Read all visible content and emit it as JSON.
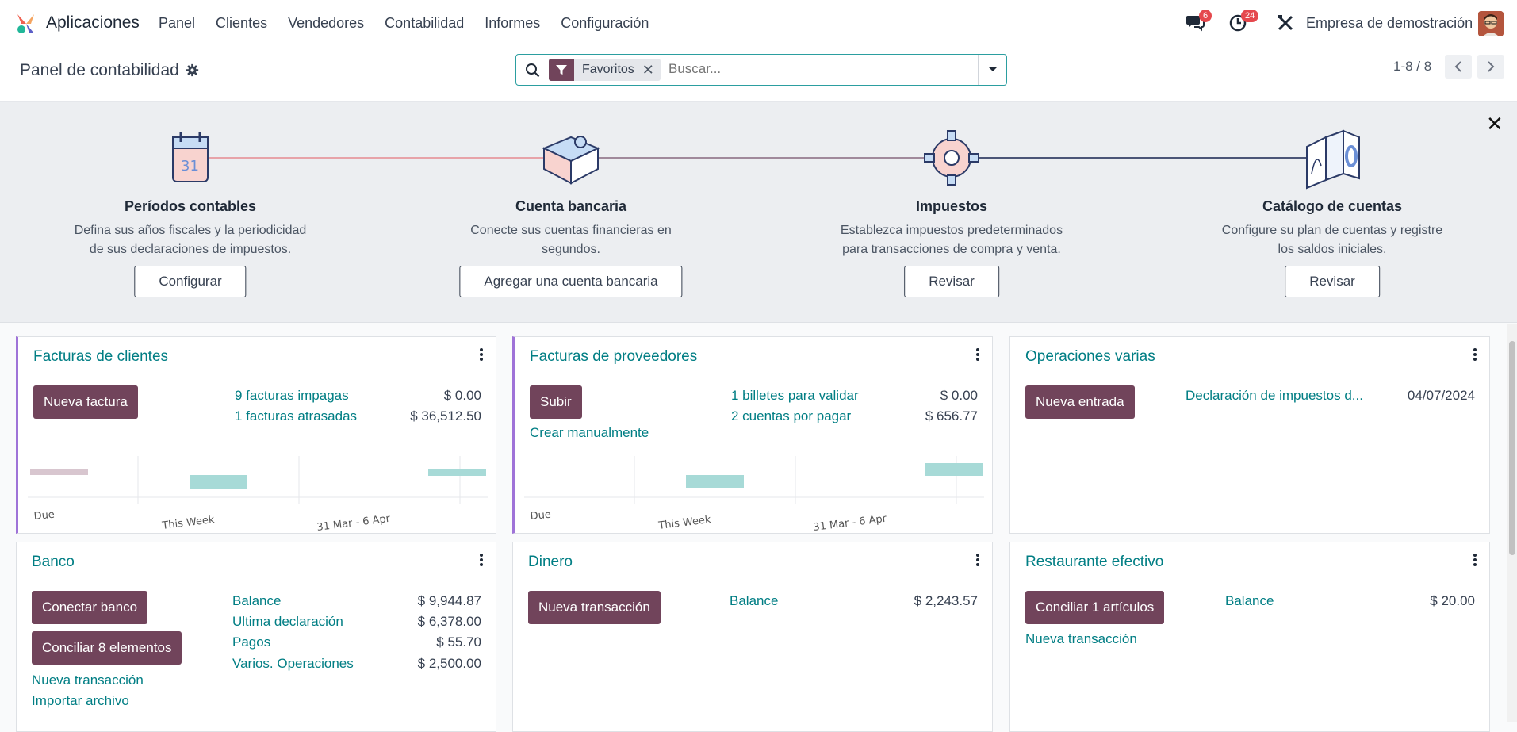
{
  "nav": {
    "app_name": "Aplicaciones",
    "menu": [
      "Panel",
      "Clientes",
      "Vendedores",
      "Contabilidad",
      "Informes",
      "Configuración"
    ],
    "messages_badge": "6",
    "activities_badge": "24",
    "company": "Empresa de demostración"
  },
  "control": {
    "title": "Panel de contabilidad",
    "facet_label": "Favoritos",
    "search_placeholder": "Buscar...",
    "pager": "1-8 / 8"
  },
  "onboarding": {
    "steps": [
      {
        "title": "Períodos contables",
        "desc1": "Defina sus años fiscales y la periodicidad",
        "desc2": "de sus declaraciones de impuestos.",
        "button": "Configurar"
      },
      {
        "title": "Cuenta bancaria",
        "desc1": "Conecte sus cuentas financieras en",
        "desc2": "segundos.",
        "button": "Agregar una cuenta bancaria"
      },
      {
        "title": "Impuestos",
        "desc1": "Establezca impuestos predeterminados",
        "desc2": "para transacciones de compra y venta.",
        "button": "Revisar"
      },
      {
        "title": "Catálogo de cuentas",
        "desc1": "Configure su plan de cuentas y registre",
        "desc2": "los saldos iniciales.",
        "button": "Revisar"
      }
    ]
  },
  "cards": {
    "sales": {
      "title": "Facturas de clientes",
      "button": "Nueva factura",
      "rows": [
        {
          "label": "9 facturas impagas",
          "value": "$ 0.00"
        },
        {
          "label": "1 facturas atrasadas",
          "value": "$ 36,512.50"
        }
      ],
      "chart_labels": [
        "Due",
        "This Week",
        "31 Mar - 6 Apr"
      ]
    },
    "purchase": {
      "title": "Facturas de proveedores",
      "button": "Subir",
      "link": "Crear manualmente",
      "rows": [
        {
          "label": "1 billetes para validar",
          "value": "$ 0.00"
        },
        {
          "label": "2 cuentas por pagar",
          "value": "$ 656.77"
        }
      ],
      "chart_labels": [
        "Due",
        "This Week",
        "31 Mar - 6 Apr"
      ]
    },
    "misc": {
      "title": "Operaciones varias",
      "button": "Nueva entrada",
      "row_label": "Declaración de impuestos d...",
      "row_value": "04/07/2024"
    },
    "bank": {
      "title": "Banco",
      "button1": "Conectar banco",
      "button2": "Conciliar 8 elementos",
      "links": [
        "Nueva transacción",
        "Importar archivo"
      ],
      "rows": [
        {
          "label": "Balance",
          "value": "$ 9,944.87"
        },
        {
          "label": "Ultima declaración",
          "value": "$ 6,378.00"
        },
        {
          "label": "Pagos",
          "value": "$ 55.70"
        },
        {
          "label": "Varios. Operaciones",
          "value": "$ 2,500.00"
        }
      ]
    },
    "cash": {
      "title": "Dinero",
      "button": "Nueva transacción",
      "row_label": "Balance",
      "row_value": "$ 2,243.57"
    },
    "resto": {
      "title": "Restaurante efectivo",
      "button": "Conciliar 1 artículos",
      "link": "Nueva transacción",
      "row_label": "Balance",
      "row_value": "$ 20.00"
    }
  },
  "colors": {
    "primary": "#71445b",
    "link": "#017e84",
    "accent_border": "#9f73d8",
    "bar_teal": "#a7dad7",
    "bar_mauve": "#d8c6cf"
  }
}
